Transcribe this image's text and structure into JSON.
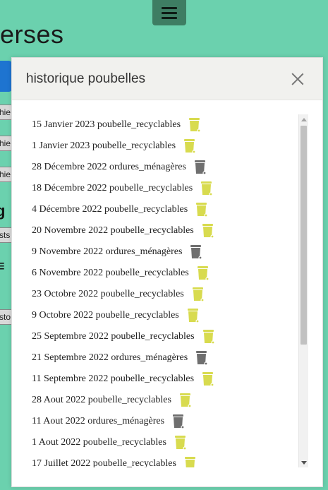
{
  "background": {
    "title_fragment": "erses",
    "side_labels": [
      "hie",
      "hie",
      "hie",
      "sts",
      "sto"
    ]
  },
  "menu": {
    "icon": "hamburger-icon"
  },
  "modal": {
    "title": "historique poubelles",
    "close_icon": "close-icon"
  },
  "colors": {
    "page_bg": "#6bd1ae",
    "recyclables_bin": "#d8db4f",
    "menagere_bin": "#6f6f6f"
  },
  "history": [
    {
      "label": "15 Janvier 2023 poubelle_recyclables",
      "type": "recyclables"
    },
    {
      "label": "1 Janvier 2023 poubelle_recyclables",
      "type": "recyclables"
    },
    {
      "label": "28 Décembre 2022 ordures_ménagères",
      "type": "menagere"
    },
    {
      "label": "18 Décembre 2022 poubelle_recyclables",
      "type": "recyclables"
    },
    {
      "label": "4 Décembre 2022 poubelle_recyclables",
      "type": "recyclables"
    },
    {
      "label": "20 Novembre 2022 poubelle_recyclables",
      "type": "recyclables"
    },
    {
      "label": "9 Novembre 2022 ordures_ménagères",
      "type": "menagere"
    },
    {
      "label": "6 Novembre 2022 poubelle_recyclables",
      "type": "recyclables"
    },
    {
      "label": "23 Octobre 2022 poubelle_recyclables",
      "type": "recyclables"
    },
    {
      "label": "9 Octobre 2022 poubelle_recyclables",
      "type": "recyclables"
    },
    {
      "label": "25 Septembre 2022 poubelle_recyclables",
      "type": "recyclables"
    },
    {
      "label": "21 Septembre 2022 ordures_ménagères",
      "type": "menagere"
    },
    {
      "label": "11 Septembre 2022 poubelle_recyclables",
      "type": "recyclables"
    },
    {
      "label": "28 Aout 2022 poubelle_recyclables",
      "type": "recyclables"
    },
    {
      "label": "11 Aout 2022 ordures_ménagères",
      "type": "menagere"
    },
    {
      "label": "1 Aout 2022 poubelle_recyclables",
      "type": "recyclables"
    },
    {
      "label": "17 Juillet 2022 poubelle_recyclables",
      "type": "recyclables"
    }
  ]
}
